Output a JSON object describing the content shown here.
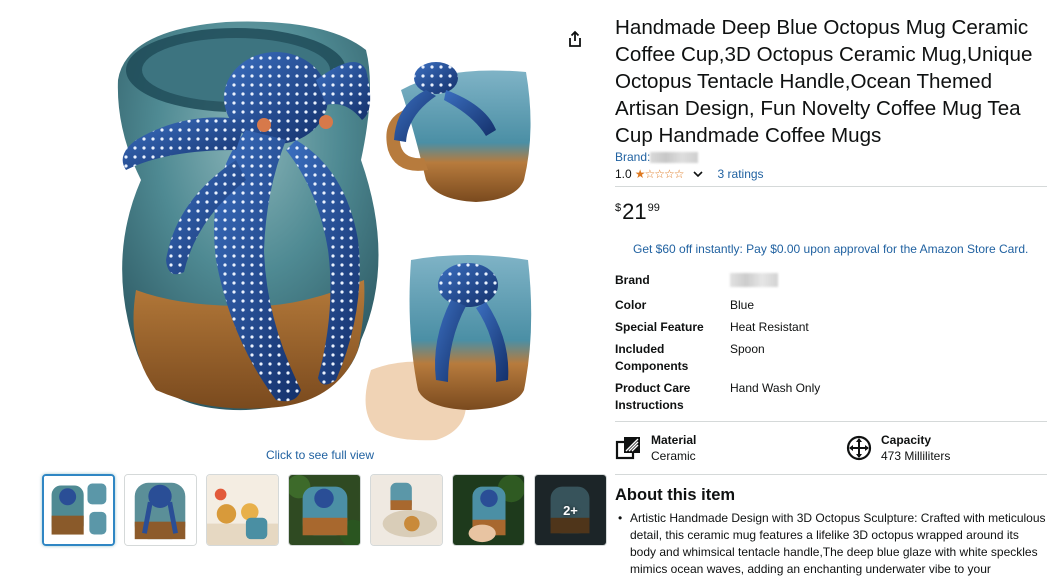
{
  "media": {
    "full_view_label": "Click to see full view",
    "thumbnails": [
      {
        "label": "thumbnail-1"
      },
      {
        "label": "thumbnail-2"
      },
      {
        "label": "thumbnail-3"
      },
      {
        "label": "thumbnail-4"
      },
      {
        "label": "thumbnail-5"
      },
      {
        "label": "thumbnail-6"
      },
      {
        "more_label": "2+"
      }
    ]
  },
  "product": {
    "title": "Handmade Deep Blue Octopus Mug Ceramic Coffee Cup,3D Octopus Ceramic Mug,Unique Octopus Tentacle Handle,Ocean Themed Artisan Design, Fun Novelty Coffee Mug Tea Cup Handmade Coffee Mugs",
    "brand_label": "Brand:",
    "rating_value": "1.0",
    "rating_stars": 1,
    "ratings_count": "3 ratings",
    "price": {
      "symbol": "$",
      "whole": "21",
      "fraction": "99"
    },
    "promo": "Get $60 off instantly: Pay $0.00 upon approval for the Amazon Store Card."
  },
  "specs": [
    {
      "key": "Brand",
      "value": ""
    },
    {
      "key": "Color",
      "value": "Blue"
    },
    {
      "key": "Special Feature",
      "value": "Heat Resistant"
    },
    {
      "key": "Included Components",
      "value": "Spoon"
    },
    {
      "key": "Product Care Instructions",
      "value": "Hand Wash Only"
    }
  ],
  "features": [
    {
      "label": "Material",
      "value": "Ceramic",
      "icon": "material-icon"
    },
    {
      "label": "Capacity",
      "value": "473 Milliliters",
      "icon": "capacity-icon"
    }
  ],
  "about": {
    "title": "About this item",
    "bullets": [
      "Artistic Handmade Design with 3D Octopus Sculpture: Crafted with meticulous detail, this ceramic mug features a lifelike 3D octopus wrapped around its body and whimsical tentacle handle,The deep blue glaze with white speckles mimics ocean waves, adding an enchanting underwater vibe to your"
    ]
  },
  "colors": {
    "link": "#2162a1",
    "star": "#de7921",
    "text": "#0f1111",
    "thumb_active_border": "#2f86c4"
  }
}
